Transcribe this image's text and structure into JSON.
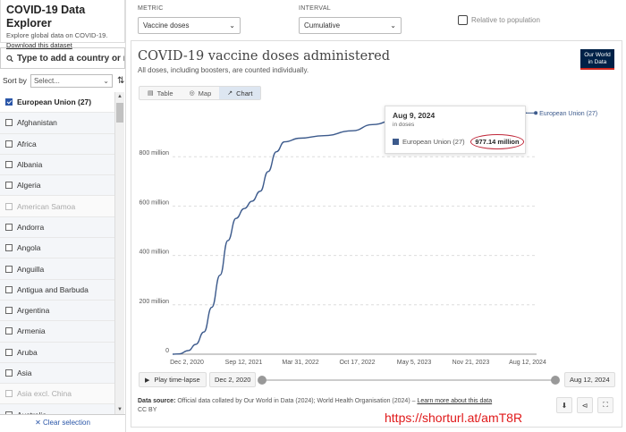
{
  "app": {
    "title": "COVID-19 Data Explorer",
    "subtitle": "Explore global data on COVID-19.",
    "download_label": "Download this dataset"
  },
  "search": {
    "placeholder": "Type to add a country or region..."
  },
  "sort": {
    "label": "Sort by",
    "selected": "Select...",
    "icon": "sort-icon"
  },
  "countries": [
    {
      "label": "European Union (27)",
      "checked": true,
      "disabled": false
    },
    {
      "label": "Afghanistan",
      "checked": false,
      "disabled": false
    },
    {
      "label": "Africa",
      "checked": false,
      "disabled": false
    },
    {
      "label": "Albania",
      "checked": false,
      "disabled": false
    },
    {
      "label": "Algeria",
      "checked": false,
      "disabled": false
    },
    {
      "label": "American Samoa",
      "checked": false,
      "disabled": true
    },
    {
      "label": "Andorra",
      "checked": false,
      "disabled": false
    },
    {
      "label": "Angola",
      "checked": false,
      "disabled": false
    },
    {
      "label": "Anguilla",
      "checked": false,
      "disabled": false
    },
    {
      "label": "Antigua and Barbuda",
      "checked": false,
      "disabled": false
    },
    {
      "label": "Argentina",
      "checked": false,
      "disabled": false
    },
    {
      "label": "Armenia",
      "checked": false,
      "disabled": false
    },
    {
      "label": "Aruba",
      "checked": false,
      "disabled": false
    },
    {
      "label": "Asia",
      "checked": false,
      "disabled": false
    },
    {
      "label": "Asia excl. China",
      "checked": false,
      "disabled": true
    },
    {
      "label": "Australia",
      "checked": false,
      "disabled": false
    }
  ],
  "clear_selection": "✕ Clear selection",
  "controls": {
    "metric_label": "METRIC",
    "metric_value": "Vaccine doses",
    "interval_label": "INTERVAL",
    "interval_value": "Cumulative",
    "relative_label": "Relative to population"
  },
  "chart": {
    "title": "COVID-19 vaccine doses administered",
    "subtitle": "All doses, including boosters, are counted individually.",
    "logo_line1": "Our World",
    "logo_line2": "in Data",
    "tabs": [
      {
        "label": "Table",
        "icon": "table-icon",
        "active": false
      },
      {
        "label": "Map",
        "icon": "globe-icon",
        "active": false
      },
      {
        "label": "Chart",
        "icon": "line-chart-icon",
        "active": true
      }
    ]
  },
  "chart_data": {
    "type": "line",
    "title": "COVID-19 vaccine doses administered",
    "xlabel": "",
    "ylabel": "",
    "x_ticks": [
      "Dec 2, 2020",
      "Sep 12, 2021",
      "Mar 31, 2022",
      "Oct 17, 2022",
      "May 5, 2023",
      "Nov 21, 2023",
      "Aug 12, 2024"
    ],
    "y_ticks": [
      "0",
      "200 million",
      "400 million",
      "600 million",
      "800 million"
    ],
    "ylim": [
      0,
      1000000000
    ],
    "xlim": [
      "2020-12-02",
      "2024-08-12"
    ],
    "series": [
      {
        "name": "European Union (27)",
        "color": "#3c5a8c",
        "points": [
          [
            "2020-12-02",
            0
          ],
          [
            "2020-12-27",
            1000000
          ],
          [
            "2021-01-31",
            15000000
          ],
          [
            "2021-02-28",
            40000000
          ],
          [
            "2021-03-31",
            90000000
          ],
          [
            "2021-04-30",
            190000000
          ],
          [
            "2021-05-31",
            320000000
          ],
          [
            "2021-06-30",
            460000000
          ],
          [
            "2021-07-31",
            550000000
          ],
          [
            "2021-08-31",
            590000000
          ],
          [
            "2021-09-30",
            620000000
          ],
          [
            "2021-10-31",
            660000000
          ],
          [
            "2021-11-30",
            740000000
          ],
          [
            "2021-12-31",
            820000000
          ],
          [
            "2022-01-31",
            860000000
          ],
          [
            "2022-03-31",
            875000000
          ],
          [
            "2022-06-30",
            885000000
          ],
          [
            "2022-10-17",
            905000000
          ],
          [
            "2022-12-31",
            930000000
          ],
          [
            "2023-03-31",
            950000000
          ],
          [
            "2023-05-05",
            960000000
          ],
          [
            "2023-11-21",
            970000000
          ],
          [
            "2024-08-09",
            977140000
          ]
        ]
      }
    ]
  },
  "tooltip": {
    "date": "Aug 9, 2024",
    "unit": "in doses",
    "series": "European Union (27)",
    "value": "977.14 million"
  },
  "timeline": {
    "play_label": "Play time-lapse",
    "start_date": "Dec 2, 2020",
    "end_date": "Aug 12, 2024"
  },
  "source": {
    "label": "Data source:",
    "text": "Official data collated by Our World in Data (2024); World Health Organisation (2024) –",
    "link": "Learn more about this data",
    "license": "CC BY"
  },
  "watermark": "https://shorturl.at/amT8R"
}
